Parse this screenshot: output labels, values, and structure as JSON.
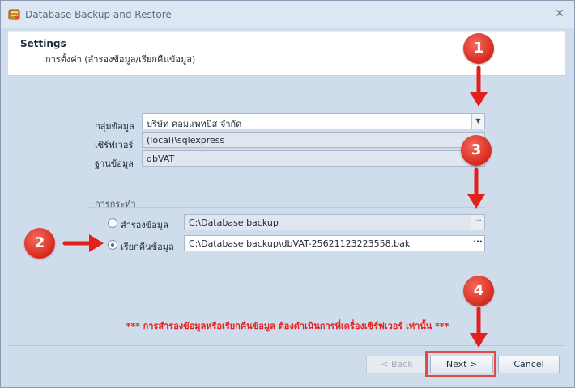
{
  "window": {
    "title": "Database Backup and Restore",
    "close_glyph": "✕"
  },
  "header": {
    "title": "Settings",
    "subtitle": "การตั้งค่า (สำรองข้อมูล/เรียกคืนข้อมูล)"
  },
  "form": {
    "group_label": "กลุ่มข้อมูล",
    "group_value": "บริษัท คอมแพทบิส จำกัด",
    "server_label": "เซิร์ฟเวอร์",
    "server_value": "(local)\\sqlexpress",
    "database_label": "ฐานข้อมูล",
    "database_value": "dbVAT"
  },
  "action": {
    "group_title": "การกระทำ",
    "backup_label": "สำรองข้อมูล",
    "backup_path": "C:\\Database backup",
    "restore_label": "เรียกคืนข้อมูล",
    "restore_path": "C:\\Database backup\\dbVAT-25621123223558.bak",
    "selected": "restore",
    "ellipsis": "···"
  },
  "note": "*** การสำรองข้อมูลหรือเรียกคืนข้อมูล ต้องดำเนินการที่เครื่องเซิร์ฟเวอร์ เท่านั้น ***",
  "buttons": {
    "back": "< Back",
    "next": "Next >",
    "cancel": "Cancel"
  },
  "annotations": {
    "badges": [
      "1",
      "2",
      "3",
      "4"
    ],
    "color": "#e3201b"
  },
  "icons": {
    "app": "database-app-icon",
    "dropdown": "chevron-down-icon",
    "browse": "ellipsis-icon"
  }
}
